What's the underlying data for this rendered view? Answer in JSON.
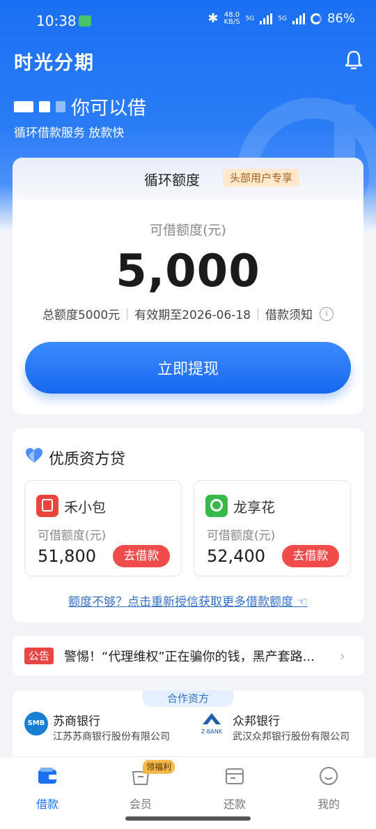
{
  "status_bar": {
    "time": "10:38",
    "net_speed_top": "48.0",
    "net_speed_unit": "KB/S",
    "net1": "5G",
    "net2": "5G",
    "battery": "86%"
  },
  "header": {
    "brand": "时光分期",
    "greeting_suffix": "你可以借",
    "subtitle": "循环借款服务 放款快"
  },
  "quota_card": {
    "title": "循环额度",
    "tag": "头部用户专享",
    "amount_label": "可借额度(元)",
    "amount": "5,000",
    "total": "总额度5000元",
    "valid": "有效期至2026-06-18",
    "notice_link": "借款须知",
    "cta": "立即提现"
  },
  "quality": {
    "title": "优质资方贷",
    "lenders": [
      {
        "name": "禾小包",
        "label": "可借额度(元)",
        "amount": "51,800",
        "button": "去借款",
        "logo_color": "#e8453c"
      },
      {
        "name": "龙享花",
        "label": "可借额度(元)",
        "amount": "52,400",
        "button": "去借款",
        "logo_color": "#37b84a"
      }
    ],
    "more_link": "额度不够？点击重新授信获取更多借款额度"
  },
  "notice": {
    "tag": "公告",
    "text": "警惕！“代理维权”正在骗你的钱，黑产套路..."
  },
  "partners": {
    "tag": "合作资方",
    "items": [
      {
        "name": "苏商银行",
        "desc": "江苏苏商银行股份有限公司",
        "logo": "SMB"
      },
      {
        "name": "众邦银行",
        "desc": "武汉众邦银行股份有限公司",
        "logo": "Z-BANK"
      }
    ]
  },
  "tabbar": {
    "badge": "领福利",
    "items": [
      {
        "label": "借款",
        "icon": "wallet-icon"
      },
      {
        "label": "会员",
        "icon": "member-bag-icon"
      },
      {
        "label": "还款",
        "icon": "repay-card-icon"
      },
      {
        "label": "我的",
        "icon": "profile-face-icon"
      }
    ]
  },
  "colors": {
    "primary": "#1b6ff2",
    "danger": "#f04c4c",
    "tag_bg": "#fde8cc"
  }
}
